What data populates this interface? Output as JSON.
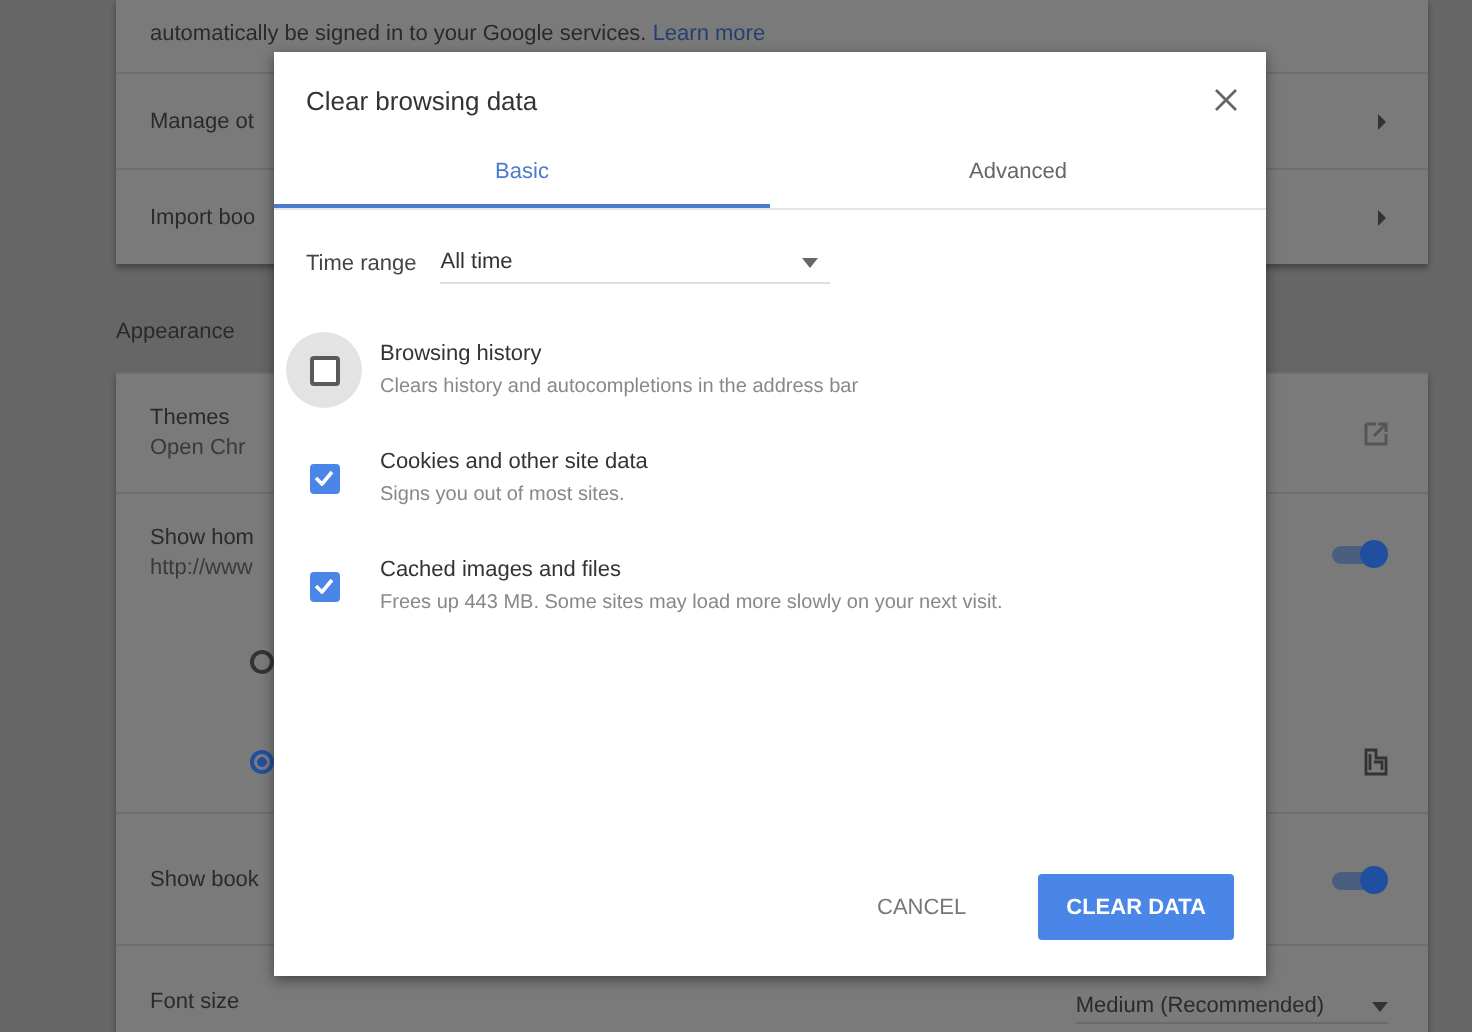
{
  "background": {
    "signin_text": "automatically be signed in to your Google services.",
    "signin_link": "Learn more",
    "rows1": [
      {
        "label": "Manage ot"
      },
      {
        "label": "Import boo"
      }
    ],
    "section_title": "Appearance",
    "rows2": [
      {
        "kind": "link",
        "label": "Themes",
        "sublabel": "Open Chr"
      },
      {
        "kind": "toggle",
        "label": "Show hom",
        "sublabel": "http://www",
        "on": true
      },
      {
        "kind": "radio",
        "selected": false
      },
      {
        "kind": "radio_extension",
        "selected": true
      },
      {
        "kind": "toggle",
        "label": "Show book",
        "on": true
      },
      {
        "kind": "dropdown",
        "label": "Font size",
        "value": "Medium (Recommended)"
      }
    ]
  },
  "dialog": {
    "title": "Clear browsing data",
    "tabs": [
      {
        "label": "Basic",
        "selected": true
      },
      {
        "label": "Advanced",
        "selected": false
      }
    ],
    "time_range": {
      "label": "Time range",
      "value": "All time"
    },
    "items": [
      {
        "title": "Browsing history",
        "description": "Clears history and autocompletions in the address bar",
        "checked": false,
        "focused": true
      },
      {
        "title": "Cookies and other site data",
        "description": "Signs you out of most sites.",
        "checked": true,
        "focused": false
      },
      {
        "title": "Cached images and files",
        "description": "Frees up 443 MB. Some sites may load more slowly on your next visit.",
        "checked": true,
        "focused": false
      }
    ],
    "buttons": [
      {
        "label": "CANCEL",
        "kind": "text"
      },
      {
        "label": "CLEAR DATA",
        "kind": "primary"
      }
    ]
  }
}
